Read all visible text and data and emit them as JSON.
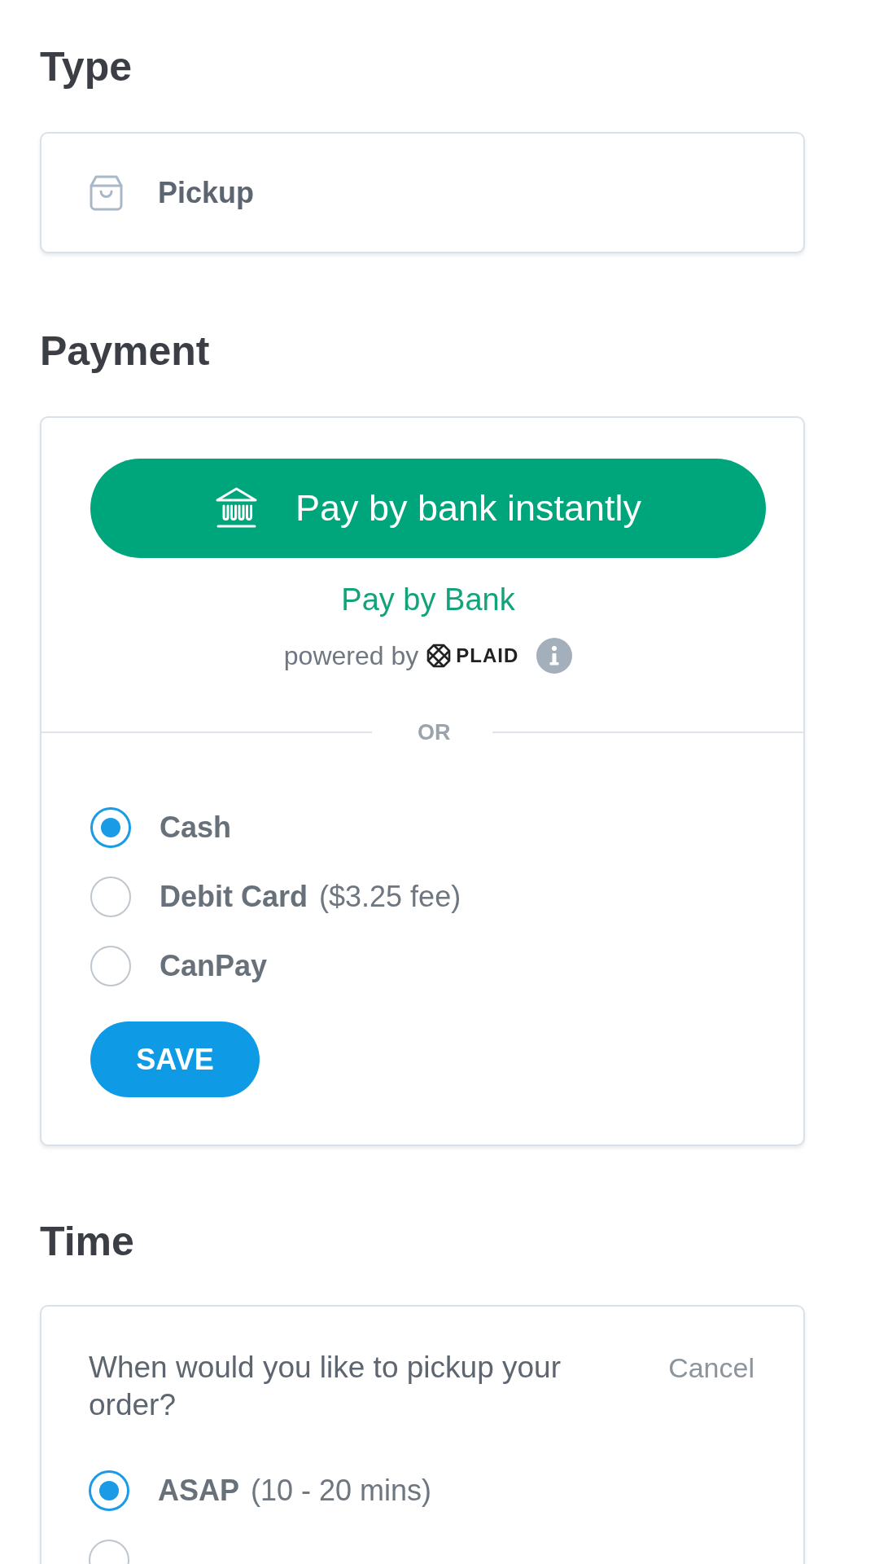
{
  "type_section": {
    "heading": "Type",
    "option": {
      "label": "Pickup"
    }
  },
  "payment_section": {
    "heading": "Payment",
    "bank_button": {
      "label": "Pay by bank instantly"
    },
    "bank_link": "Pay by Bank",
    "powered_by": {
      "text": "powered by",
      "brand": "PLAID"
    },
    "divider": "OR",
    "methods": [
      {
        "label": "Cash",
        "selected": true
      },
      {
        "label": "Debit Card",
        "note": "($3.25 fee)",
        "selected": false
      },
      {
        "label": "CanPay",
        "selected": false
      }
    ],
    "save_button": "SAVE"
  },
  "time_section": {
    "heading": "Time",
    "question": "When would you like to pickup your order?",
    "cancel": "Cancel",
    "options": [
      {
        "label": "ASAP",
        "note": "(10 - 20 mins)",
        "selected": true
      },
      {
        "selected": false
      }
    ]
  }
}
